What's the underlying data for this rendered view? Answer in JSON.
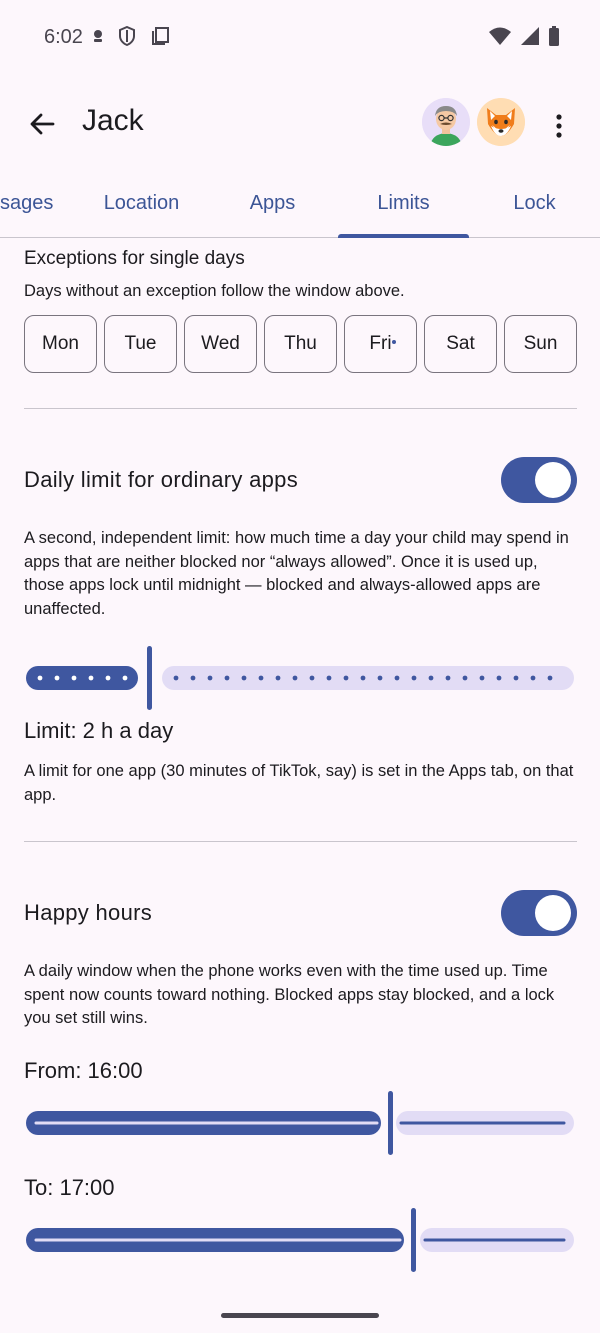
{
  "status_bar": {
    "time": "6:02"
  },
  "app_bar": {
    "title": "Jack"
  },
  "tabs": [
    {
      "label": "sages"
    },
    {
      "label": "Location"
    },
    {
      "label": "Apps"
    },
    {
      "label": "Limits",
      "selected": true
    },
    {
      "label": "Lock"
    }
  ],
  "exceptions": {
    "title": "Exceptions for single days",
    "description": "Days without an exception follow the window above.",
    "days": [
      "Mon",
      "Tue",
      "Wed",
      "Thu",
      "Fri",
      "Sat",
      "Sun"
    ]
  },
  "daily_limit": {
    "title": "Daily limit for ordinary apps",
    "enabled": true,
    "description": "A second, independent limit: how much time a day your child may spend in apps that are neither blocked nor “always allowed”. Once it is used up, those apps lock until midnight — blocked and always-allowed apps are unaffected.",
    "value_label": "Limit: 2 h a day",
    "note": "A limit for one app (30 minutes of TikTok, say) is set in the Apps tab, on that app."
  },
  "happy_hours": {
    "title": "Happy hours",
    "enabled": true,
    "description": "A daily window when the phone works even with the time used up. Time spent now counts toward nothing. Blocked apps stay blocked, and a lock you set still wins.",
    "from_label": "From: 16:00",
    "to_label": "To: 17:00"
  },
  "colors": {
    "accent": "#3f57a0",
    "track_inactive": "#e2dcf5",
    "background": "#fdf7fc"
  }
}
